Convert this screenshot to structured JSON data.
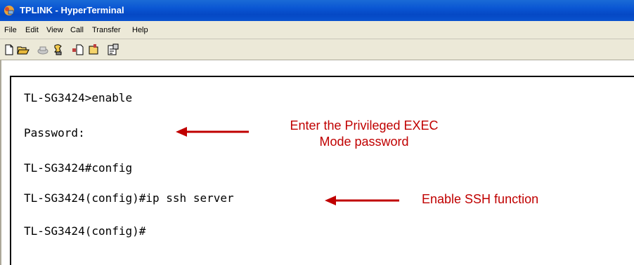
{
  "window": {
    "title": "TPLINK - HyperTerminal",
    "icon": "hyperterminal-icon"
  },
  "menubar": {
    "items": [
      "File",
      "Edit",
      "View",
      "Call",
      "Transfer",
      "Help"
    ]
  },
  "toolbar": {
    "buttons": [
      "new-icon",
      "open-icon",
      "call-icon",
      "disconnect-icon",
      "send-icon",
      "receive-icon",
      "properties-icon"
    ]
  },
  "terminal": {
    "lines": [
      "TL-SG3424>enable",
      "Password:",
      "TL-SG3424#config",
      "TL-SG3424(config)#ip ssh server",
      "TL-SG3424(config)#"
    ]
  },
  "annotations": {
    "password_note_line1": "Enter the Privileged EXEC",
    "password_note_line2": "Mode password",
    "ssh_note": "Enable SSH function",
    "color": "#c00000"
  }
}
